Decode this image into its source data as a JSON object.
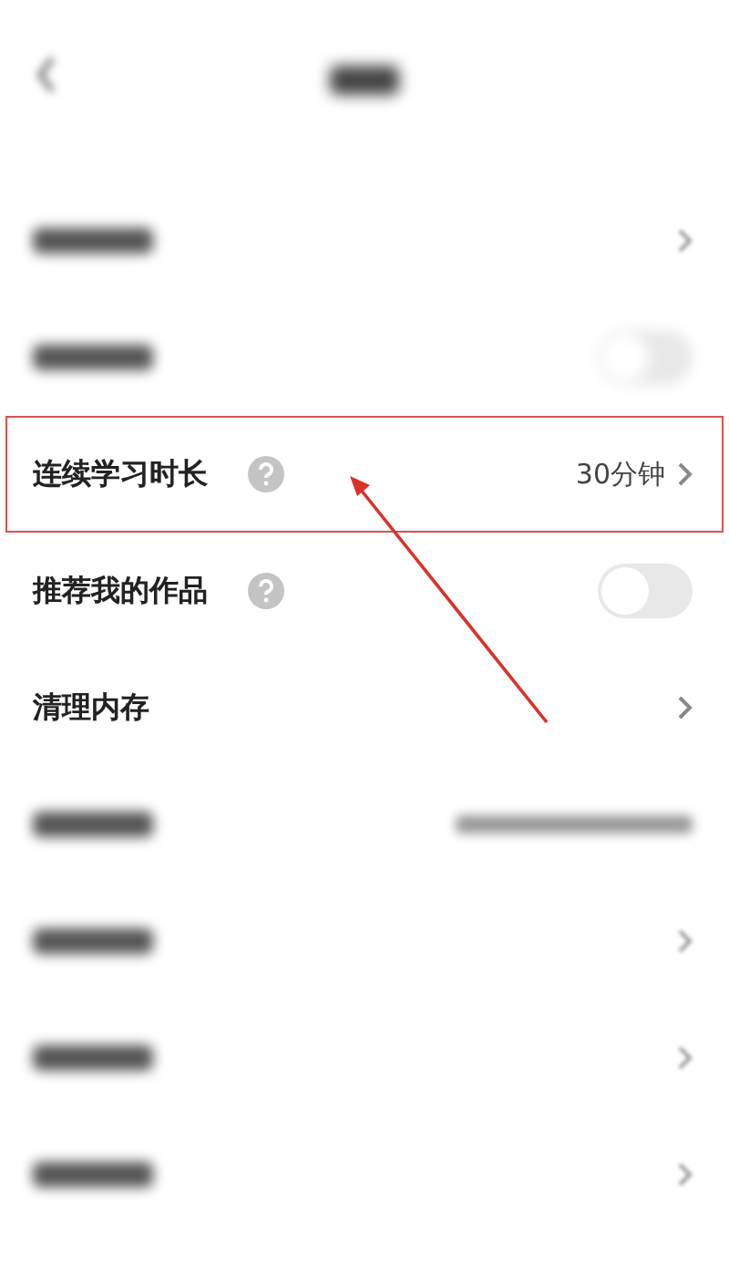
{
  "header": {
    "kind": "blurred"
  },
  "rows": [
    {
      "kind": "blurred",
      "accessory": {
        "kind": "chevron"
      }
    },
    {
      "kind": "blurred",
      "accessory": {
        "kind": "toggle"
      },
      "on": false
    },
    {
      "kind": "setting",
      "label": "连续学习时长",
      "help": true,
      "value": "30分钟",
      "accessory": {
        "kind": "chevron"
      },
      "highlighted": true
    },
    {
      "kind": "setting",
      "label": "推荐我的作品",
      "help": true,
      "accessory": {
        "kind": "toggle"
      },
      "on": false,
      "highlighted": false
    },
    {
      "kind": "setting",
      "label": "清理内存",
      "help": false,
      "accessory": {
        "kind": "chevron"
      },
      "highlighted": false
    },
    {
      "kind": "blurred",
      "accessory": {
        "kind": "value"
      }
    },
    {
      "kind": "blurred",
      "accessory": {
        "kind": "chevron"
      }
    },
    {
      "kind": "blurred",
      "accessory": {
        "kind": "chevron"
      }
    },
    {
      "kind": "blurred",
      "accessory": {
        "kind": "chevron"
      }
    }
  ],
  "annotation": {
    "kind": "arrow"
  }
}
